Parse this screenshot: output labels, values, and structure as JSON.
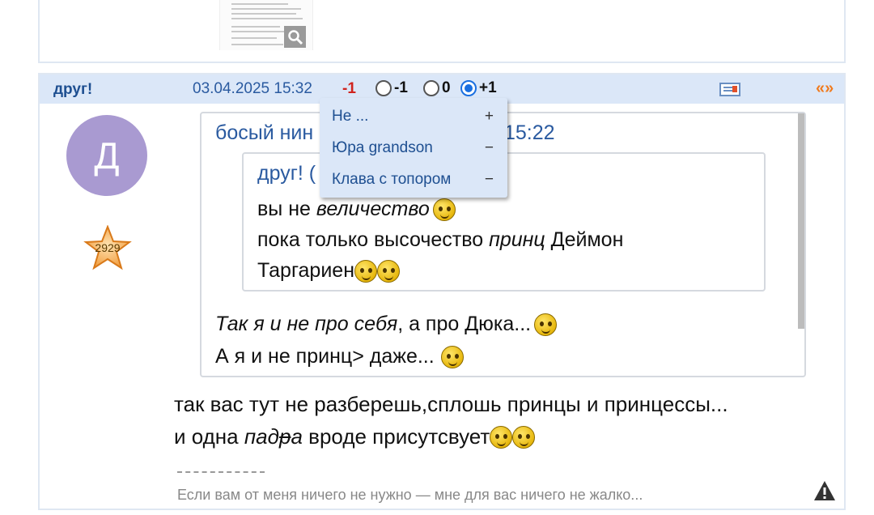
{
  "previous_post": {
    "attachment_icon": "photo-thumbnail",
    "zoom_icon": "magnifier-icon"
  },
  "post": {
    "author": "друг!",
    "date": "03.04.2025 15:32",
    "score": "-1",
    "votes": {
      "minus_label": "-1",
      "zero_label": "0",
      "plus_label": "+1",
      "selected": "+1"
    },
    "reply_icon": "quote-reply-icon",
    "nav_label": "«»",
    "avatar_letter": "Д",
    "avatar_color": "#a99ad1",
    "rank_number": "2929",
    "quote_outer": {
      "author": "босый нин",
      "time": "15:22",
      "lines": [
        {
          "italic": "Так я и не про себя",
          "rest": ", а про Дюка..."
        },
        {
          "text": "А я и не принц> даже..."
        }
      ]
    },
    "quote_inner": {
      "author": "друг! (",
      "line1_plain": "вы не ",
      "line1_italic": "величество",
      "line2_plain": "пока только высочество ",
      "line2_italic": "принц",
      "line2_rest": " Деймон",
      "line3": "Таргариен"
    },
    "body": {
      "line1": "так вас тут не разберешь,сплошь принцы и принцессы...",
      "line2_plain": "и одна ",
      "line2_italic_a": "пад",
      "line2_italic_strike": "р",
      "line2_italic_b": "а",
      "line2_rest": " вроде присутсвует"
    },
    "signature": "Если вам от меня ничего не нужно — мне для вас ничего не жалко...",
    "warning_icon": "warning-triangle-icon"
  },
  "vote_dropdown": {
    "items": [
      {
        "name": "Не ...",
        "sign": "+"
      },
      {
        "name": "Юра grandson",
        "sign": "−"
      },
      {
        "name": "Клава с топором",
        "sign": "−"
      }
    ]
  },
  "colors": {
    "header_bg": "#dbe7f8",
    "link_blue": "#2a5aa0",
    "score_red": "#d0231e",
    "nav_orange": "#f07b1e"
  }
}
